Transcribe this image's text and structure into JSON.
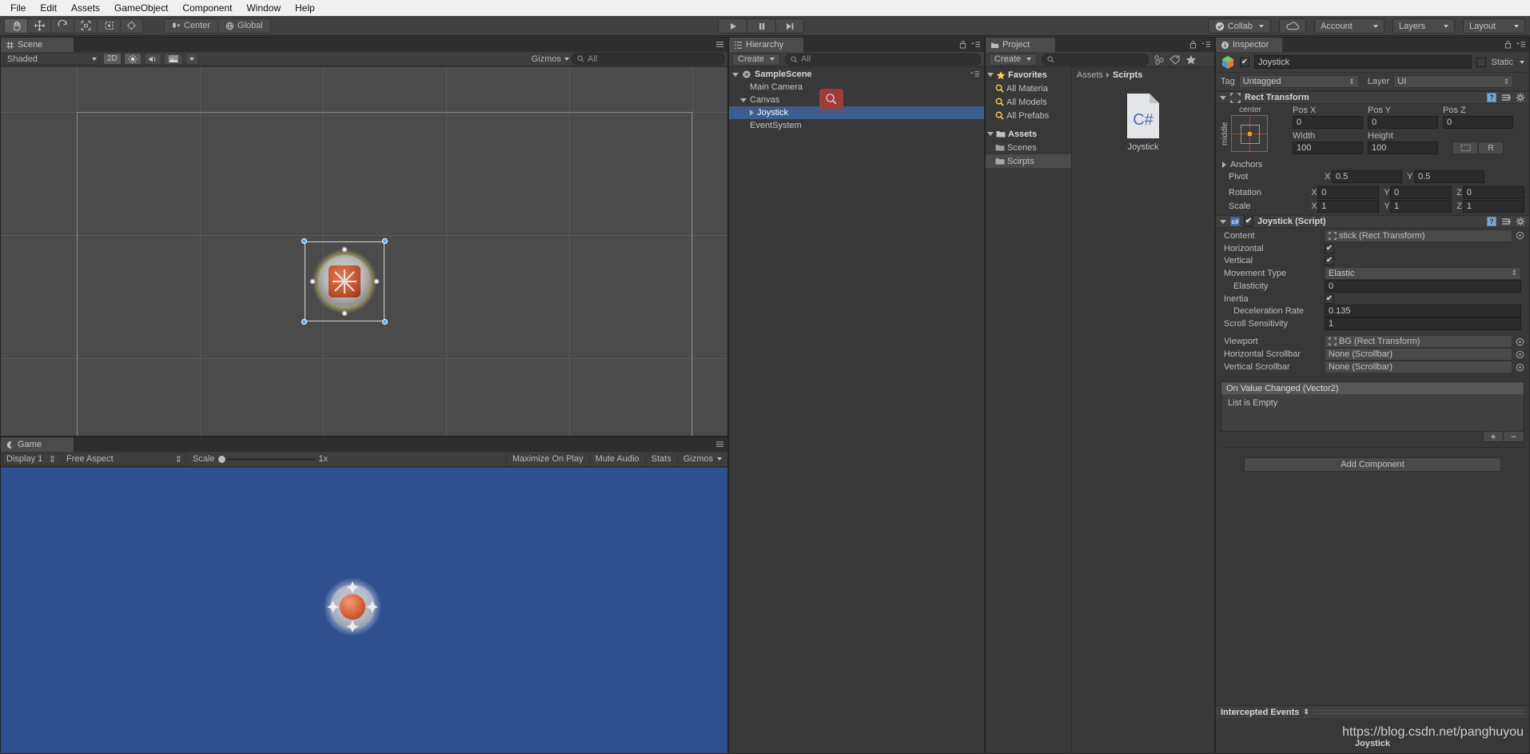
{
  "menubar": {
    "items": [
      "File",
      "Edit",
      "Assets",
      "GameObject",
      "Component",
      "Window",
      "Help"
    ]
  },
  "toolbar": {
    "tools": [
      "hand-tool",
      "move-tool",
      "rotate-tool",
      "scale-tool",
      "rect-tool",
      "transform-tool"
    ],
    "pivot_label": "Center",
    "space_label": "Global",
    "play_label": "play",
    "pause_label": "pause",
    "step_label": "step",
    "collab_label": "Collab",
    "cloud_label": "cloud",
    "account_label": "Account",
    "layers_label": "Layers",
    "layout_label": "Layout"
  },
  "scene": {
    "tab_label": "Scene",
    "shading_mode": "Shaded",
    "mode_2d": "2D",
    "lighting": "lighting-toggle",
    "audio": "audio-toggle",
    "fx": "fx-toggle",
    "gizmos_label": "Gizmos",
    "search_placeholder": "All"
  },
  "game": {
    "tab_label": "Game",
    "display": "Display 1",
    "aspect": "Free Aspect",
    "scale_label": "Scale",
    "scale_value": "1x",
    "maximize_label": "Maximize On Play",
    "mute_label": "Mute Audio",
    "stats_label": "Stats",
    "gizmos_label": "Gizmos"
  },
  "hierarchy": {
    "tab_label": "Hierarchy",
    "create_label": "Create",
    "search_placeholder": "All",
    "items": [
      {
        "label": "SampleScene",
        "depth": 0,
        "type": "scene",
        "expanded": true,
        "selected": false
      },
      {
        "label": "Main Camera",
        "depth": 1,
        "type": "gameobject",
        "expanded": false,
        "selected": false
      },
      {
        "label": "Canvas",
        "depth": 1,
        "type": "gameobject",
        "expanded": true,
        "selected": false
      },
      {
        "label": "Joystick",
        "depth": 2,
        "type": "gameobject",
        "expanded": false,
        "selected": true
      },
      {
        "label": "EventSystem",
        "depth": 1,
        "type": "gameobject",
        "expanded": false,
        "selected": false
      }
    ]
  },
  "project": {
    "tab_label": "Project",
    "create_label": "Create",
    "search_placeholder": "",
    "breadcrumb": [
      "Assets",
      "Scirpts"
    ],
    "tree": [
      {
        "label": "Favorites",
        "depth": 0,
        "icon": "star-icon",
        "bold": true,
        "selected": false
      },
      {
        "label": "All Materia",
        "depth": 1,
        "icon": "search-icon",
        "bold": false,
        "selected": false
      },
      {
        "label": "All Models",
        "depth": 1,
        "icon": "search-icon",
        "bold": false,
        "selected": false
      },
      {
        "label": "All Prefabs",
        "depth": 1,
        "icon": "search-icon",
        "bold": false,
        "selected": false
      },
      {
        "label": "Assets",
        "depth": 0,
        "icon": "folder-icon",
        "bold": true,
        "selected": false
      },
      {
        "label": "Scenes",
        "depth": 1,
        "icon": "folder-icon",
        "bold": false,
        "selected": false
      },
      {
        "label": "Scirpts",
        "depth": 1,
        "icon": "folder-icon",
        "bold": false,
        "selected": true
      }
    ],
    "assets": [
      {
        "label": "Joystick",
        "type": "C#"
      }
    ]
  },
  "inspector": {
    "tab_label": "Inspector",
    "object_name": "Joystick",
    "object_enabled": true,
    "static_label": "Static",
    "tag_label": "Tag",
    "tag_value": "Untagged",
    "layer_label": "Layer",
    "layer_value": "UI",
    "rect_transform": {
      "title": "Rect Transform",
      "anchor_preset_h": "center",
      "anchor_preset_v": "middle",
      "pos_x_label": "Pos X",
      "pos_x": "0",
      "pos_y_label": "Pos Y",
      "pos_y": "0",
      "pos_z_label": "Pos Z",
      "pos_z": "0",
      "width_label": "Width",
      "width": "100",
      "height_label": "Height",
      "height": "100",
      "blueprint_label": "R",
      "anchors_label": "Anchors",
      "pivot_label": "Pivot",
      "pivot_x": "0.5",
      "pivot_y": "0.5",
      "rotation_label": "Rotation",
      "rot_x": "0",
      "rot_y": "0",
      "rot_z": "0",
      "scale_label": "Scale",
      "scale_x": "1",
      "scale_y": "1",
      "scale_z": "1"
    },
    "joystick_script": {
      "title": "Joystick (Script)",
      "enabled": true,
      "rows": [
        {
          "label": "Content",
          "kind": "object",
          "value": "stick (Rect Transform)",
          "indent": false
        },
        {
          "label": "Horizontal",
          "kind": "bool",
          "value": true,
          "indent": false
        },
        {
          "label": "Vertical",
          "kind": "bool",
          "value": true,
          "indent": false
        },
        {
          "label": "Movement Type",
          "kind": "enum",
          "value": "Elastic",
          "indent": false
        },
        {
          "label": "Elasticity",
          "kind": "number",
          "value": "0",
          "indent": true
        },
        {
          "label": "Inertia",
          "kind": "bool",
          "value": true,
          "indent": false
        },
        {
          "label": "Deceleration Rate",
          "kind": "number",
          "value": "0.135",
          "indent": true
        },
        {
          "label": "Scroll Sensitivity",
          "kind": "number",
          "value": "1",
          "indent": false
        },
        {
          "label": "Viewport",
          "kind": "object",
          "value": "BG (Rect Transform)",
          "indent": false
        },
        {
          "label": "Horizontal Scrollbar",
          "kind": "object",
          "value": "None (Scrollbar)",
          "indent": false
        },
        {
          "label": "Vertical Scrollbar",
          "kind": "object",
          "value": "None (Scrollbar)",
          "indent": false
        }
      ],
      "event_header": "On Value Changed (Vector2)",
      "event_empty": "List is Empty",
      "add_label": "+",
      "remove_label": "−"
    },
    "add_component_label": "Add Component",
    "intercepted_events_label": "Intercepted Events",
    "preview_title": "Joystick"
  },
  "watermark": "https://blog.csdn.net/panghuyou",
  "colors": {
    "selection_blue": "#3d5d8c",
    "game_background": "#2f4f8f",
    "panel_bg": "#383838",
    "accent_orange": "#c85a3a"
  }
}
